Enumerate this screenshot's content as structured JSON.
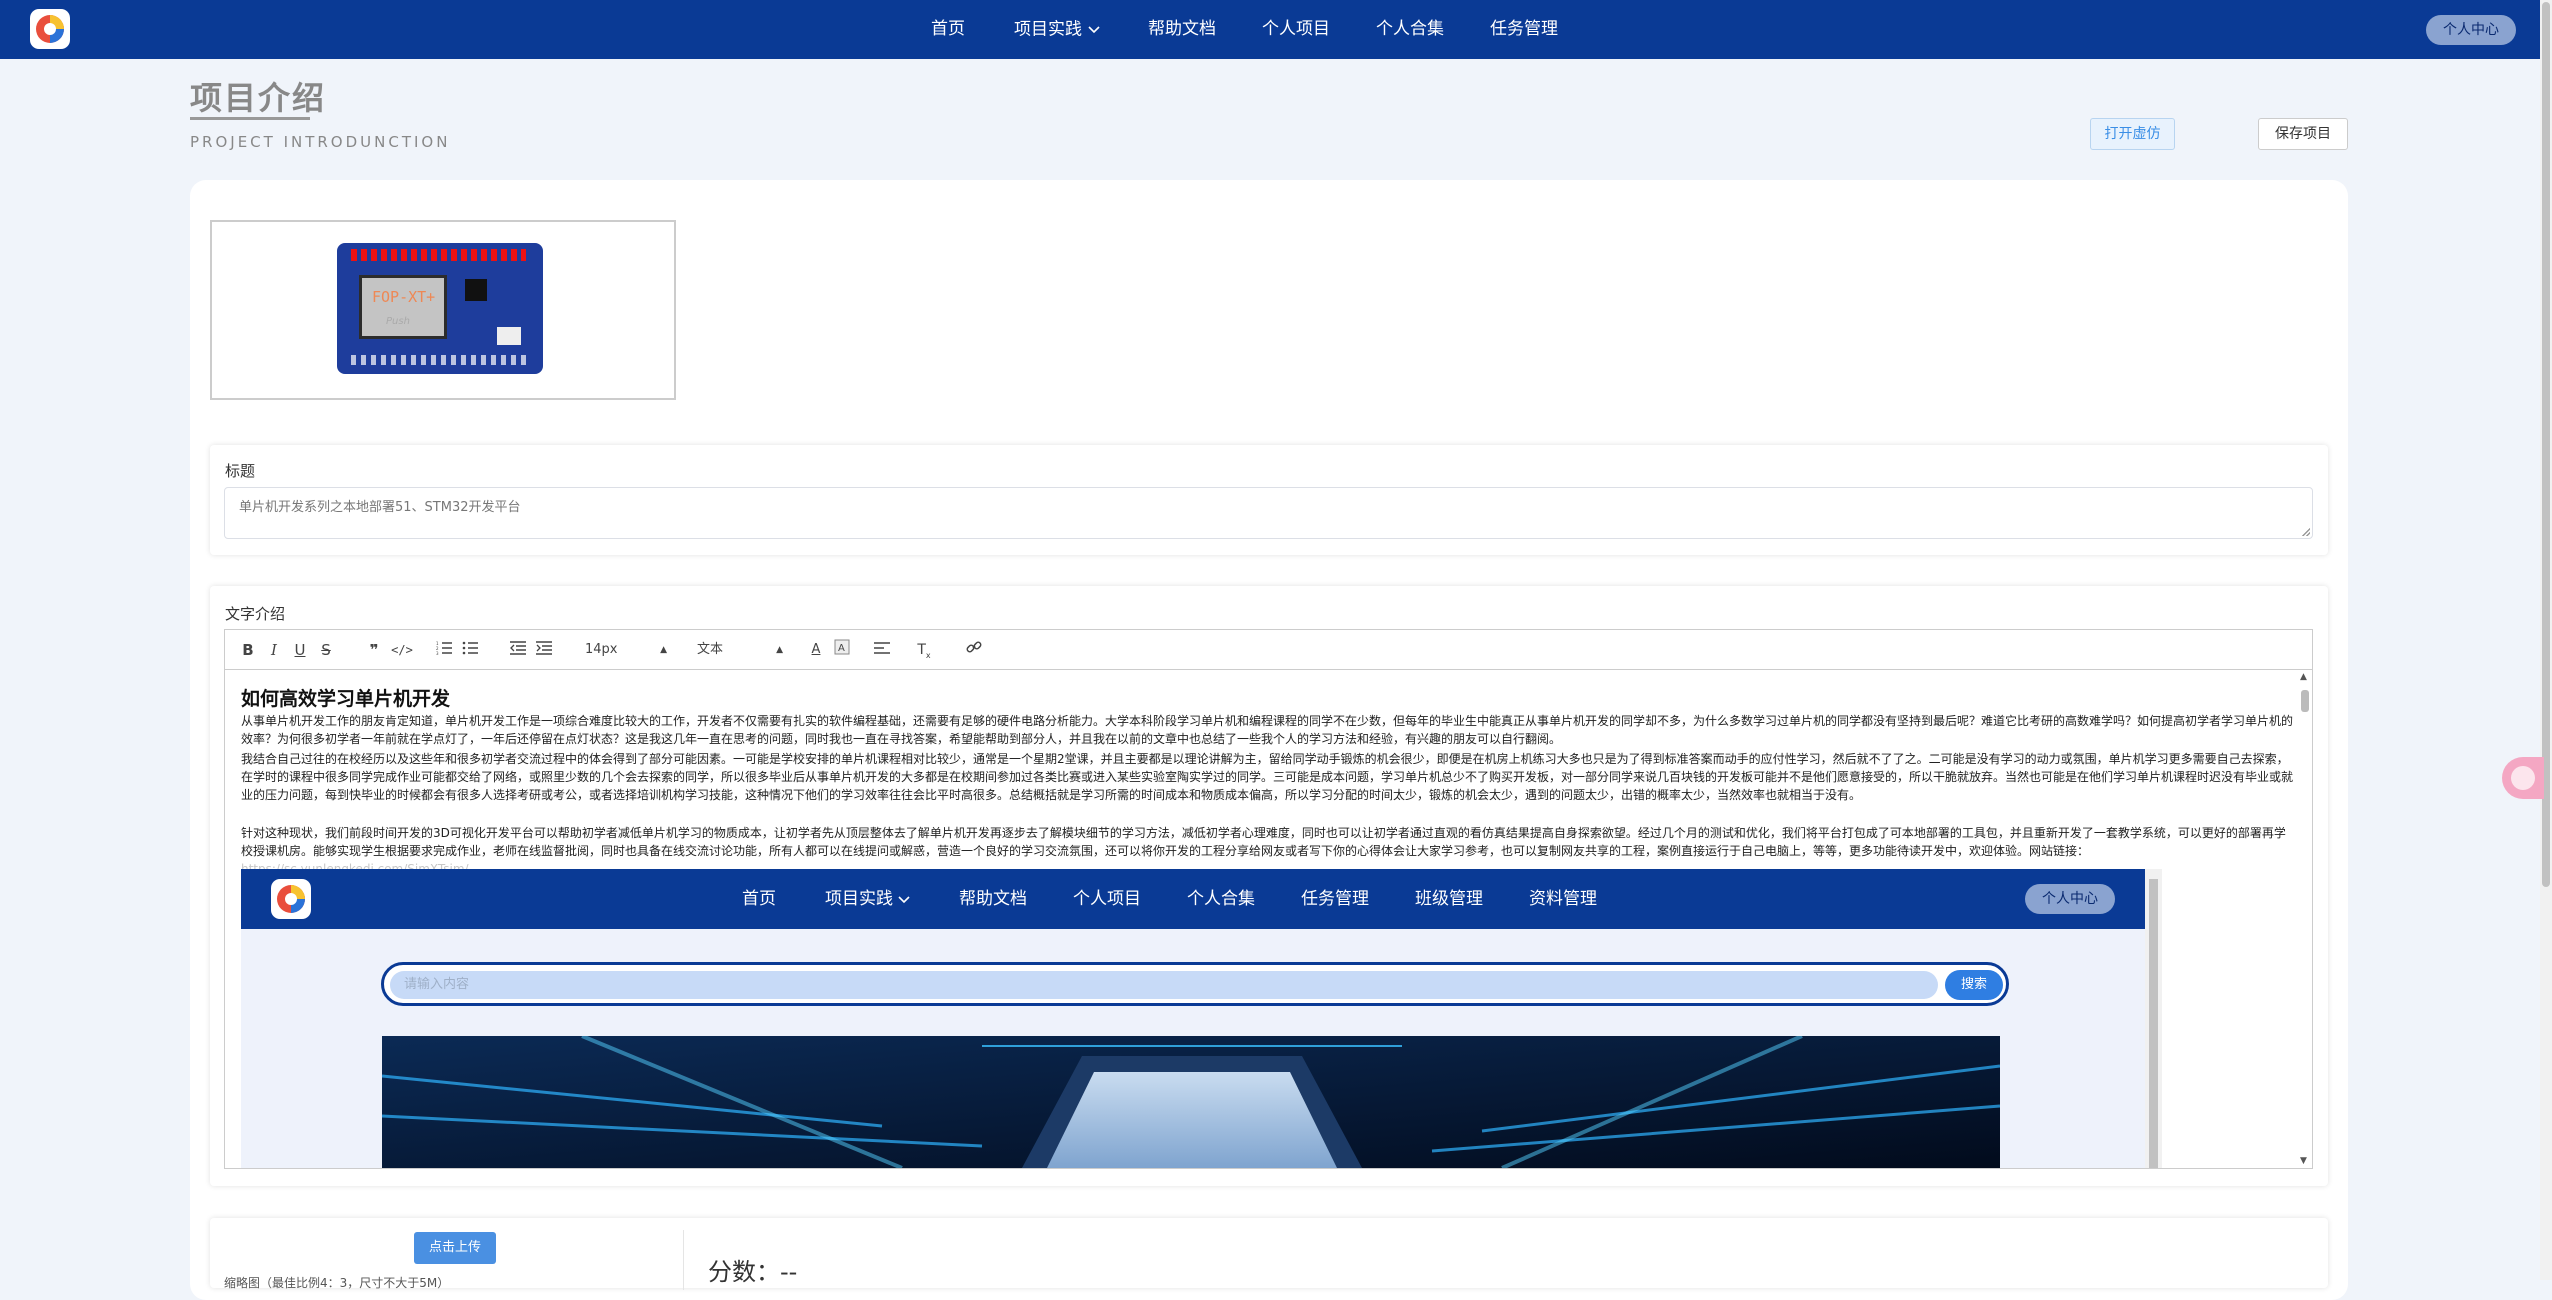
{
  "nav": {
    "items": [
      {
        "label": "首页"
      },
      {
        "label": "项目实践",
        "has_dropdown": true
      },
      {
        "label": "帮助文档"
      },
      {
        "label": "个人项目"
      },
      {
        "label": "个人合集"
      },
      {
        "label": "任务管理"
      }
    ],
    "user_label": "个人中心"
  },
  "header": {
    "title": "项目介绍",
    "subtitle": "PROJECT INTRODUNCTION",
    "open_sim_label": "打开虚仿",
    "save_label": "保存项目"
  },
  "project_image": {
    "board_text": "FOP-XT+",
    "board_subtext": "Push"
  },
  "title_field": {
    "label": "标题",
    "value": "单片机开发系列之本地部署51、STM32开发平台"
  },
  "intro": {
    "label": "文字介绍",
    "toolbar": {
      "font_size": "14px",
      "block_type": "文本"
    },
    "heading": "如何高效学习单片机开发",
    "paragraphs": [
      "从事单片机开发工作的朋友肯定知道，单片机开发工作是一项综合难度比较大的工作，开发者不仅需要有扎实的软件编程基础，还需要有足够的硬件电路分析能力。大学本科阶段学习单片机和编程课程的同学不在少数，但每年的毕业生中能真正从事单片机开发的同学却不多，为什么多数学习过单片机的同学都没有坚持到最后呢？难道它比考研的高数难学吗？如何提高初学者学习单片机的效率？为何很多初学者一年前就在学点灯了，一年后还停留在点灯状态？这是我这几年一直在思考的问题，同时我也一直在寻找答案，希望能帮助到部分人，并且我在以前的文章中也总结了一些我个人的学习方法和经验，有兴趣的朋友可以自行翻阅。",
      "我结合自己过往的在校经历以及这些年和很多初学者交流过程中的体会得到了部分可能因素。一可能是学校安排的单片机课程相对比较少，通常是一个星期2堂课，并且主要都是以理论讲解为主，留给同学动手锻炼的机会很少，即便是在机房上机练习大多也只是为了得到标准答案而动手的应付性学习，然后就不了了之。二可能是没有学习的动力或氛围，单片机学习更多需要自己去探索，在学时的课程中很多同学完成作业可能都交给了网络，或照里少数的几个会去探索的同学，所以很多毕业后从事单片机开发的大多都是在校期间参加过各类比赛或进入某些实验室陶实学过的同学。三可能是成本问题，学习单片机总少不了购买开发板，对一部分同学来说几百块钱的开发板可能并不是他们愿意接受的，所以干脆就放弃。当然也可能是在他们学习单片机课程时迟没有毕业或就业的压力问题，每到快毕业的时候都会有很多人选择考研或考公，或者选择培训机构学习技能，这种情况下他们的学习效率往往会比平时高很多。总结概括就是学习所需的时间成本和物质成本偏高，所以学习分配的时间太少，锻炼的机会太少，遇到的问题太少，出错的概率太少，当然效率也就相当于没有。",
      "针对这种现状，我们前段时间开发的3D可视化开发平台可以帮助初学者减低单片机学习的物质成本，让初学者先从顶层整体去了解单片机开发再逐步去了解模块细节的学习方法，减低初学者心理难度，同时也可以让初学者通过直观的看仿真结果提高自身探索欲望。经过几个月的测试和优化，我们将平台打包成了可本地部署的工具包，并且重新开发了一套教学系统，可以更好的部署再学校授课机房。能够实现学生根据要求完成作业，老师在线监督批阅，同时也具备在线交流讨论功能，所有人都可以在线提问或解惑，营造一个良好的学习交流氛围，还可以将你开发的工程分享给网友或者写下你的心得体会让大家学习参考，也可以复制网友共享的工程，案例直接运行于自己电脑上，等等，更多功能待读开发中，欢迎体验。网站链接："
    ],
    "link_text": "https://sc.yunlengkedi.com/SimXTsim/"
  },
  "embed": {
    "nav_items": [
      "首页",
      "项目实践",
      "帮助文档",
      "个人项目",
      "个人合集",
      "任务管理",
      "班级管理",
      "资料管理"
    ],
    "user_label": "个人中心",
    "search_placeholder": "请输入内容",
    "search_button": "搜索"
  },
  "bottom": {
    "upload_label": "点击上传",
    "score_label": "分数：--",
    "cut_text": "缩略图（最佳比例4：3，尺寸不大于5M）"
  },
  "colors": {
    "nav_bg": "#0a3a95",
    "page_bg": "#f0f4fa",
    "accent_blue": "#4a90e2"
  }
}
